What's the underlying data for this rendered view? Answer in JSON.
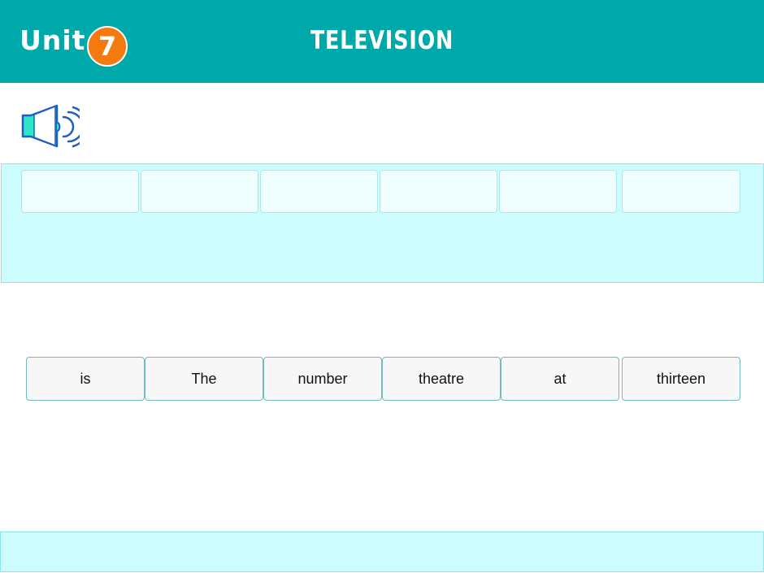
{
  "header": {
    "unit_label": "Unit",
    "unit_number": "7",
    "title": "TELEVISION",
    "color": "#00a9a9",
    "badge_color": "#f47a0f"
  },
  "audio": {
    "icon": "speaker-icon"
  },
  "answer_slots": [
    "",
    "",
    "",
    "",
    "",
    ""
  ],
  "words": [
    "is",
    "The",
    "number",
    "theatre",
    "at",
    "thirteen"
  ],
  "colors": {
    "answer_area": "#ccfcfe",
    "tile": "#f7f7f7",
    "tile_border": "#6fbcc0"
  }
}
